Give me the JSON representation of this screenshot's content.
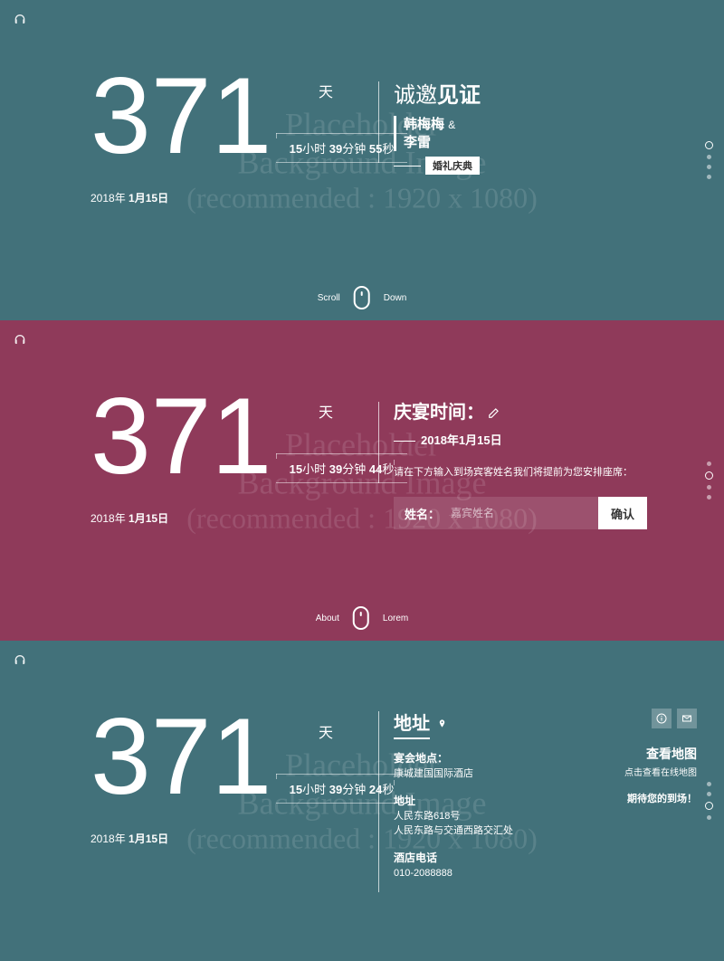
{
  "watermark": {
    "line1": "Placeholder",
    "line2": "Background Image",
    "line3": "(recommended : 1920 x 1080)"
  },
  "countdown1": {
    "days": "371",
    "day_label": "天",
    "hours": "15",
    "h_unit": "小时",
    "minutes": "39",
    "m_unit": "分钟",
    "seconds": "55",
    "s_unit": "秒",
    "date_prefix": "2018年",
    "date": "1月15日"
  },
  "countdown2": {
    "days": "371",
    "day_label": "天",
    "hours": "15",
    "h_unit": "小时",
    "minutes": "39",
    "m_unit": "分钟",
    "seconds": "44",
    "s_unit": "秒",
    "date_prefix": "2018年",
    "date": "1月15日"
  },
  "countdown3": {
    "days": "371",
    "day_label": "天",
    "hours": "15",
    "h_unit": "小时",
    "minutes": "39",
    "m_unit": "分钟",
    "seconds": "24",
    "s_unit": "秒",
    "date_prefix": "2018年",
    "date": "1月15日"
  },
  "hero": {
    "invite_pre": "诚邀",
    "invite_bold": "见证",
    "name1": "韩梅梅",
    "amp": "&",
    "name2": "李雷",
    "ceremony": "婚礼庆典"
  },
  "scroll": {
    "left": "Scroll",
    "right": "Down"
  },
  "section2": {
    "title": "庆宴时间：",
    "date": "2018年1月15日",
    "instruction": "请在下方输入到场宾客姓名我们将提前为您安排座席：",
    "name_label": "姓名：",
    "placeholder": "嘉宾姓名",
    "confirm": "确认",
    "scroll_left": "About",
    "scroll_right": "Lorem"
  },
  "section3": {
    "title": "地址",
    "venue_label": "宴会地点：",
    "venue": "康城建国国际酒店",
    "addr_label": "地址",
    "addr1": "人民东路618号",
    "addr2": "人民东路与交通西路交汇处",
    "phone_label": "酒店电话",
    "phone": "010-2088888",
    "map_title": "查看地图",
    "map_sub": "点击查看在线地图",
    "expect": "期待您的到场！"
  }
}
